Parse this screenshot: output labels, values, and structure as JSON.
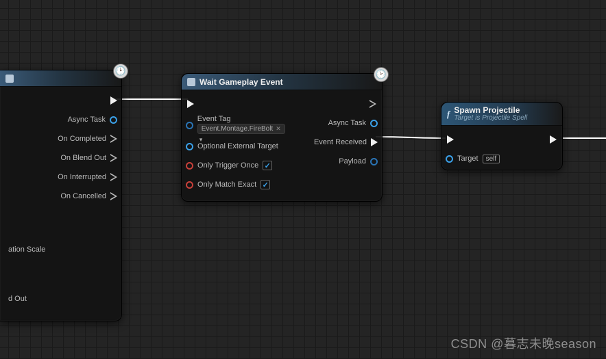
{
  "node1": {
    "outputs": {
      "exec_label": "",
      "async_task": "Async Task",
      "on_completed": "On Completed",
      "on_blend_out": "On Blend Out",
      "on_interrupted": "On Interrupted",
      "on_cancelled": "On Cancelled"
    },
    "inputs": {
      "ation_scale": "ation Scale",
      "d_out": "d Out"
    }
  },
  "node2": {
    "title": "Wait Gameplay Event",
    "inputs": {
      "event_tag_label": "Event Tag",
      "event_tag_value": "Event.Montage.FireBolt",
      "optional_ext_target": "Optional External Target",
      "only_trigger_once": "Only Trigger Once",
      "only_match_exact": "Only Match Exact",
      "only_trigger_once_checked": "✓",
      "only_match_exact_checked": "✓"
    },
    "outputs": {
      "async_task": "Async Task",
      "event_received": "Event Received",
      "payload": "Payload"
    }
  },
  "node3": {
    "title": "Spawn Projectile",
    "subtitle": "Target is Projectile Spell",
    "inputs": {
      "target_label": "Target",
      "target_value": "self"
    }
  },
  "watermark": "CSDN @暮志未晚season"
}
